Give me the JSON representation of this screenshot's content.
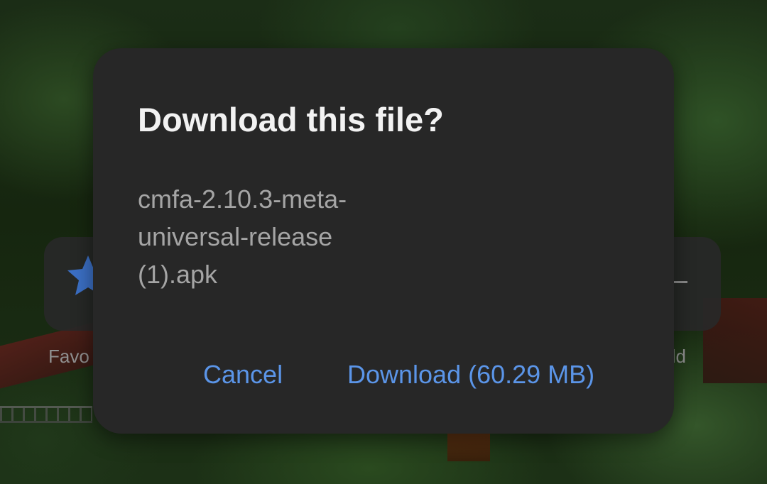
{
  "dialog": {
    "title": "Download this file?",
    "filename_lines": [
      "cmfa-2.10.3-meta-",
      "universal-release",
      "(1).apk"
    ],
    "cancel_label": "Cancel",
    "download_label": "Download (60.29 MB)",
    "accent_color": "#5b95e8"
  },
  "background": {
    "tiles": [
      {
        "label": "Favo",
        "icon": "star-icon"
      },
      {
        "label": "dd",
        "icon": "dash-icon"
      }
    ]
  }
}
